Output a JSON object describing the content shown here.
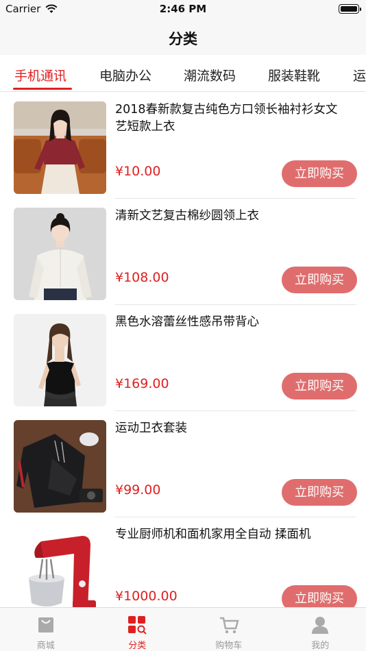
{
  "status_bar": {
    "carrier": "Carrier",
    "time": "2:46 PM"
  },
  "nav": {
    "title": "分类"
  },
  "category_tabs": [
    "手机通讯",
    "电脑办公",
    "潮流数码",
    "服装鞋靴",
    "运"
  ],
  "active_tab_index": 0,
  "products": [
    {
      "title": "2018春新款复古纯色方口领长袖衬衫女文艺短款上衣",
      "price": "¥10.00",
      "buy_label": "立即购买"
    },
    {
      "title": "清新文艺复古棉纱圆领上衣",
      "price": "¥108.00",
      "buy_label": "立即购买"
    },
    {
      "title": "黑色水溶蕾丝性感吊带背心",
      "price": "¥169.00",
      "buy_label": "立即购买"
    },
    {
      "title": "运动卫衣套装",
      "price": "¥99.00",
      "buy_label": "立即购买"
    },
    {
      "title": "专业厨师机和面机家用全自动 揉面机",
      "price": "¥1000.00",
      "buy_label": "立即购买"
    }
  ],
  "tabbar": [
    {
      "label": "商城",
      "icon": "shop-bag-icon",
      "active": false
    },
    {
      "label": "分类",
      "icon": "category-grid-icon",
      "active": true
    },
    {
      "label": "购物车",
      "icon": "cart-icon",
      "active": false
    },
    {
      "label": "我的",
      "icon": "user-icon",
      "active": false
    }
  ],
  "colors": {
    "accent": "#e02020",
    "buy_button": "#e06d6d",
    "inactive_tab": "#999999"
  }
}
